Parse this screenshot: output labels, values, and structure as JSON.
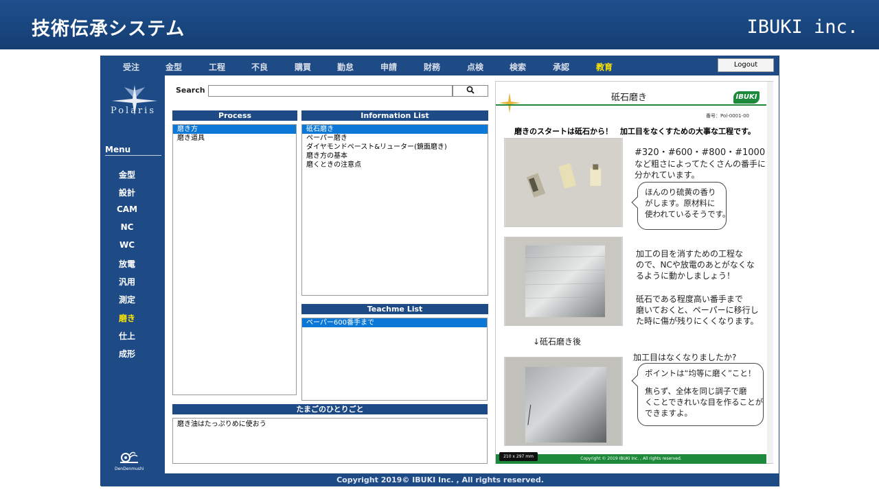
{
  "banner": {
    "title": "技術伝承システム",
    "brand": "IBUKI inc."
  },
  "topnav": {
    "items": [
      "受注",
      "金型",
      "工程",
      "不良",
      "購買",
      "勤怠",
      "申請",
      "財務",
      "点検",
      "検索",
      "承認",
      "教育"
    ],
    "active_item": "教育",
    "logout_label": "Logout"
  },
  "sidebar": {
    "logo_text": "Polaris",
    "menu_heading": "Menu",
    "items": [
      "金型",
      "設計",
      "CAM",
      "NC",
      "WC",
      "放電",
      "汎用",
      "測定",
      "磨き",
      "仕上",
      "成形"
    ],
    "active_item": "磨き",
    "mascot_label": "DenDenmushi"
  },
  "search": {
    "label": "Search",
    "value": "",
    "button_icon": "search-icon"
  },
  "process": {
    "heading": "Process",
    "items": [
      "磨き方",
      "磨き道具"
    ],
    "selected": "磨き方"
  },
  "information": {
    "heading": "Information List",
    "items": [
      "砥石磨き",
      "ペーパー磨き",
      "ダイヤモンドペースト&リューター(鏡面磨き)",
      "磨き方の基本",
      "磨くときの注意点"
    ],
    "selected": "砥石磨き"
  },
  "teachme": {
    "heading": "Teachme List",
    "items": [
      "ペーパー600番手まで"
    ],
    "selected": "ペーパー600番手まで"
  },
  "tamago": {
    "heading": "たまごのひとりごと",
    "text": "磨き油はたっぷりめに使おう"
  },
  "document": {
    "title": "砥石磨き",
    "logo_text": "IBUKI",
    "number": "番号：Pol-0001-00",
    "headline": "磨きのスタートは砥石から！　加工目をなくすための大事な工程です。",
    "note1": [
      "#320・#600・#800・#1000",
      "など粗さによってたくさんの番手に",
      "分かれています。"
    ],
    "bubble1": [
      "ほんのり硫黄の香り",
      "がします。原材料に",
      "使われているそうです。"
    ],
    "note2": [
      "加工の目を消すための工程な",
      "ので、NCや放電のあとがなくな",
      "るように動かしましょう！",
      "",
      "砥石である程度高い番手まで",
      "磨いておくと、ペーパーに移行し",
      "た時に傷が残りにくくなります。"
    ],
    "after_label": "↓砥石磨き後",
    "note3": "加工目はなくなりましたか?",
    "bubble2": [
      "ポイントは“均等に磨く”こと！",
      "",
      "焦らず、全体を同じ調子で磨",
      "くことできれいな目を作ることが",
      "できますよ。"
    ],
    "footer": "Copyright © 2019 IBUKI Inc. , All rights reserved.",
    "size_badge": "210 x 297 mm"
  },
  "footer": {
    "text": "Copyright 2019©  IBUKI Inc. , All rights reserved."
  },
  "colors": {
    "navy": "#1e4a86",
    "highlight": "#ffe600",
    "selection": "#0b78d7",
    "doc_green": "#1d8a3b"
  }
}
